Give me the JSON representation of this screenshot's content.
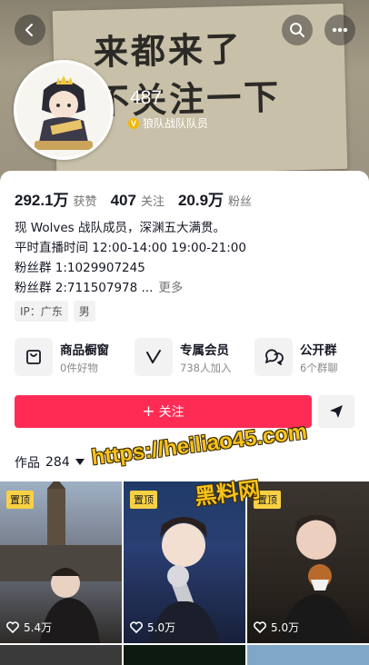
{
  "header": {
    "poster_line1": "来都来了",
    "poster_line2": "不关注一下",
    "back_icon": "chevron-left-icon",
    "search_icon": "search-icon",
    "more_icon": "more-dots-icon"
  },
  "profile": {
    "nickname": "487",
    "verify_badge": "V",
    "verify_text": "狼队战队队员",
    "stats": [
      {
        "num": "292.1万",
        "label": "获赞"
      },
      {
        "num": "407",
        "label": "关注"
      },
      {
        "num": "20.9万",
        "label": "粉丝"
      }
    ],
    "bio": {
      "line1": "现 Wolves 战队成员，深渊五大满贯。",
      "line2": "平时直播时间 12:00-14:00 19:00-21:00",
      "line3": "粉丝群 1:1029907245",
      "line4": "粉丝群 2:711507978 ...",
      "more": "更多"
    },
    "tags": [
      "IP：广东",
      "男"
    ]
  },
  "features": [
    {
      "title": "商品橱窗",
      "sub": "0件好物",
      "icon": "shop-window-icon"
    },
    {
      "title": "专属会员",
      "sub": "738人加入",
      "icon": "member-v-icon"
    },
    {
      "title": "公开群",
      "sub": "6个群聊",
      "icon": "chat-group-icon"
    }
  ],
  "actions": {
    "follow_plus": "+",
    "follow_label": "关注",
    "share_icon": "send-icon"
  },
  "works": {
    "label": "作品",
    "count": "284",
    "dropdown_icon": "triangle-down-icon"
  },
  "watermark": {
    "url": "https://heiliao45.com",
    "name": "黑料网"
  },
  "videos": [
    {
      "pin": "置顶",
      "likes": "5.4万"
    },
    {
      "pin": "置顶",
      "likes": "5.0万"
    },
    {
      "pin": "置顶",
      "likes": "5.0万"
    }
  ],
  "colors": {
    "accent": "#fe2c55",
    "pin_bg": "#f8d043",
    "verify": "#f2b900",
    "watermark": "#f7c21a"
  }
}
